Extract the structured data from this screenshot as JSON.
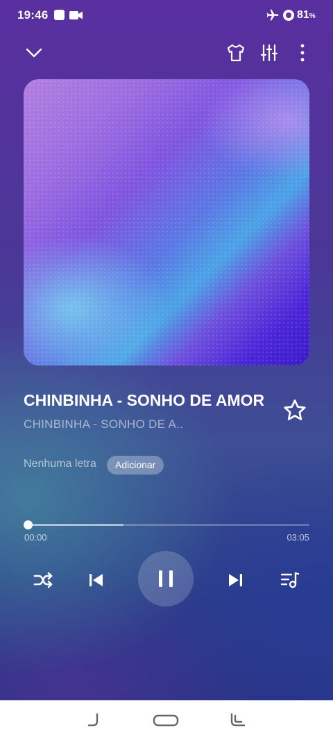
{
  "status_bar": {
    "time": "19:46",
    "battery": "81",
    "battery_unit": "%",
    "icons": [
      "notification-square-icon",
      "video-camera-icon",
      "airplane-icon",
      "battery-ring-icon"
    ]
  },
  "toolbar": {
    "icons": [
      "chevron-down-icon",
      "shirt-icon",
      "equalizer-icon",
      "more-vert-icon"
    ]
  },
  "song": {
    "title": "CHINBINHA - SONHO DE AMOR",
    "artist": "CHINBINHA - SONHO DE A..",
    "favorite_icon": "star-outline-icon"
  },
  "lyrics": {
    "label": "Nenhuma letra",
    "add_label": "Adicionar"
  },
  "playback": {
    "current_time": "00:00",
    "total_time": "03:05",
    "progress": 0.0,
    "buffered": 0.34
  },
  "controls": {
    "icons": [
      "shuffle-icon",
      "previous-icon",
      "pause-icon",
      "next-icon",
      "playlist-icon"
    ]
  },
  "nav_bar": {
    "icons": [
      "back-gesture-icon",
      "home-pill-icon",
      "recents-icon"
    ]
  },
  "colors": {
    "background_top": "#5a2fa0",
    "background_bottom": "#273085",
    "nav_bar": "#ffffff"
  }
}
